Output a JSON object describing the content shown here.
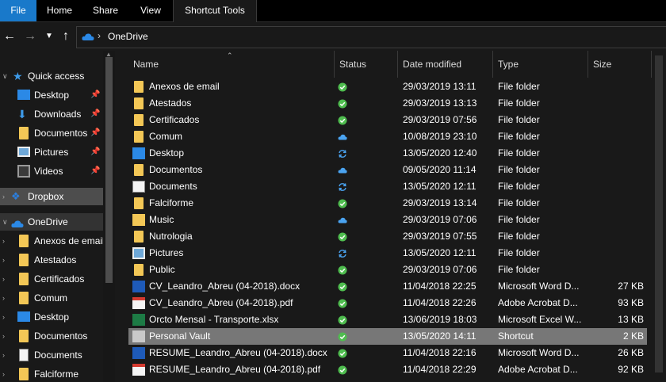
{
  "ribbon": {
    "tabs": [
      "File",
      "Home",
      "Share",
      "View",
      "Shortcut Tools"
    ]
  },
  "address": {
    "path": "OneDrive",
    "icon": "onedrive-cloud-icon"
  },
  "nav": {
    "quick_access": {
      "label": "Quick access",
      "items": [
        {
          "label": "Desktop",
          "icon": "desktop-icon",
          "pinned": true
        },
        {
          "label": "Downloads",
          "icon": "downloads-icon",
          "pinned": true
        },
        {
          "label": "Documentos",
          "icon": "folder-icon",
          "pinned": true
        },
        {
          "label": "Pictures",
          "icon": "pictures-icon",
          "pinned": true
        },
        {
          "label": "Videos",
          "icon": "videos-icon",
          "pinned": true
        }
      ]
    },
    "dropbox": {
      "label": "Dropbox"
    },
    "onedrive": {
      "label": "OneDrive",
      "items": [
        {
          "label": "Anexos de email",
          "icon": "folder-icon"
        },
        {
          "label": "Atestados",
          "icon": "folder-icon"
        },
        {
          "label": "Certificados",
          "icon": "folder-icon"
        },
        {
          "label": "Comum",
          "icon": "folder-icon"
        },
        {
          "label": "Desktop",
          "icon": "desktop-icon"
        },
        {
          "label": "Documentos",
          "icon": "folder-icon"
        },
        {
          "label": "Documents",
          "icon": "documents-icon"
        },
        {
          "label": "Falciforme",
          "icon": "folder-icon"
        }
      ]
    }
  },
  "columns": {
    "name": "Name",
    "status": "Status",
    "date": "Date modified",
    "type": "Type",
    "size": "Size"
  },
  "files": [
    {
      "name": "Anexos de email",
      "status": "synced",
      "date": "29/03/2019 13:11",
      "type": "File folder",
      "size": "",
      "icon": "folder"
    },
    {
      "name": "Atestados",
      "status": "synced",
      "date": "29/03/2019 13:13",
      "type": "File folder",
      "size": "",
      "icon": "folder"
    },
    {
      "name": "Certificados",
      "status": "synced",
      "date": "29/03/2019 07:56",
      "type": "File folder",
      "size": "",
      "icon": "folder"
    },
    {
      "name": "Comum",
      "status": "cloud",
      "date": "10/08/2019 23:10",
      "type": "File folder",
      "size": "",
      "icon": "folder"
    },
    {
      "name": "Desktop",
      "status": "syncing",
      "date": "13/05/2020 12:40",
      "type": "File folder",
      "size": "",
      "icon": "desktop"
    },
    {
      "name": "Documentos",
      "status": "cloud",
      "date": "09/05/2020 11:14",
      "type": "File folder",
      "size": "",
      "icon": "folder"
    },
    {
      "name": "Documents",
      "status": "syncing",
      "date": "13/05/2020 12:11",
      "type": "File folder",
      "size": "",
      "icon": "documents"
    },
    {
      "name": "Falciforme",
      "status": "synced",
      "date": "29/03/2019 13:14",
      "type": "File folder",
      "size": "",
      "icon": "folder"
    },
    {
      "name": "Music",
      "status": "cloud",
      "date": "29/03/2019 07:06",
      "type": "File folder",
      "size": "",
      "icon": "music"
    },
    {
      "name": "Nutrologia",
      "status": "synced",
      "date": "29/03/2019 07:55",
      "type": "File folder",
      "size": "",
      "icon": "folder"
    },
    {
      "name": "Pictures",
      "status": "syncing",
      "date": "13/05/2020 12:11",
      "type": "File folder",
      "size": "",
      "icon": "pictures"
    },
    {
      "name": "Public",
      "status": "synced",
      "date": "29/03/2019 07:06",
      "type": "File folder",
      "size": "",
      "icon": "folder"
    },
    {
      "name": "CV_Leandro_Abreu (04-2018).docx",
      "status": "synced",
      "date": "11/04/2018 22:25",
      "type": "Microsoft Word D...",
      "size": "27 KB",
      "icon": "word"
    },
    {
      "name": "CV_Leandro_Abreu (04-2018).pdf",
      "status": "synced",
      "date": "11/04/2018 22:26",
      "type": "Adobe Acrobat D...",
      "size": "93 KB",
      "icon": "pdf"
    },
    {
      "name": "Orcto Mensal - Transporte.xlsx",
      "status": "synced",
      "date": "13/06/2019 18:03",
      "type": "Microsoft Excel W...",
      "size": "13 KB",
      "icon": "excel"
    },
    {
      "name": "Personal Vault",
      "status": "synced",
      "date": "13/05/2020 14:11",
      "type": "Shortcut",
      "size": "2 KB",
      "icon": "vault",
      "selected": true
    },
    {
      "name": "RESUME_Leandro_Abreu (04-2018).docx",
      "status": "synced",
      "date": "11/04/2018 22:16",
      "type": "Microsoft Word D...",
      "size": "26 KB",
      "icon": "word"
    },
    {
      "name": "RESUME_Leandro_Abreu (04-2018).pdf",
      "status": "synced",
      "date": "11/04/2018 22:29",
      "type": "Adobe Acrobat D...",
      "size": "92 KB",
      "icon": "pdf"
    }
  ],
  "colors": {
    "accent": "#1979ca",
    "synced": "#4fbd4f",
    "cloud_sync": "#4aa3f0",
    "selection": "#777777"
  }
}
